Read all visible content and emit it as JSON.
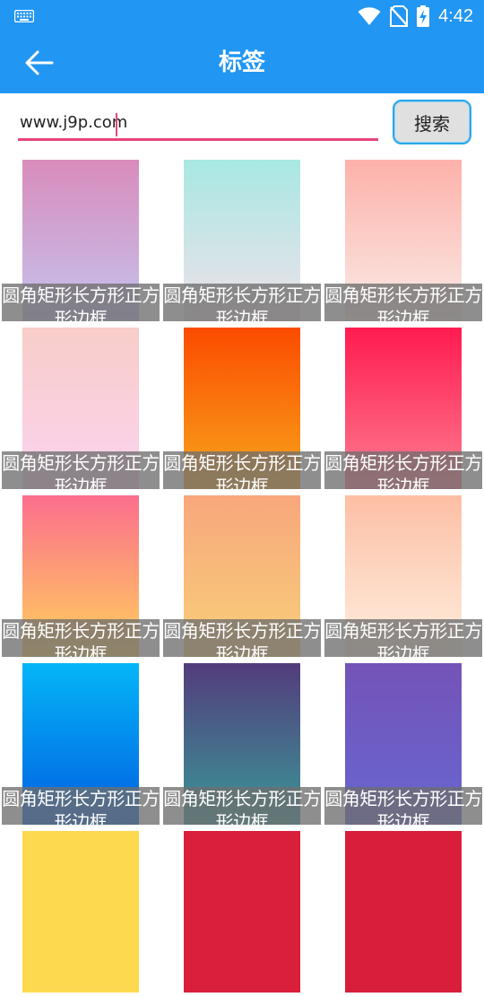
{
  "status_bar": {
    "time": "4:42"
  },
  "app_bar": {
    "title": "标签"
  },
  "search": {
    "value": "www.j9p.com",
    "button_label": "搜索"
  },
  "tiles": [
    {
      "caption": "圆角矩形长方形正方形边框",
      "gradient": [
        "#d98cbc",
        "#c4c3ee"
      ]
    },
    {
      "caption": "圆角矩形长方形正方形边框",
      "gradient": [
        "#a8e8e3",
        "#f0e1e9"
      ]
    },
    {
      "caption": "圆角矩形长方形正方形边框",
      "gradient": [
        "#fdb1aa",
        "#faebe6"
      ]
    },
    {
      "caption": "圆角矩形长方形正方形边框",
      "gradient": [
        "#f8cdc9",
        "#fbd3ef"
      ]
    },
    {
      "caption": "圆角矩形长方形正方形边框",
      "gradient": [
        "#fb4b00",
        "#f8a61c"
      ]
    },
    {
      "caption": "圆角矩形长方形正方形边框",
      "gradient": [
        "#ff1b4f",
        "#fd7d91"
      ]
    },
    {
      "caption": "圆角矩形长方形正方形边框",
      "gradient": [
        "#fb6e8d",
        "#ffd25c"
      ]
    },
    {
      "caption": "圆角矩形长方形正方形边框",
      "gradient": [
        "#f8a77c",
        "#f8cf79"
      ]
    },
    {
      "caption": "圆角矩形长方形正方形边框",
      "gradient": [
        "#fdbfa5",
        "#feefdf"
      ]
    },
    {
      "caption": "圆角矩形长方形正方形边框",
      "gradient": [
        "#04b6f8",
        "#025ee1"
      ]
    },
    {
      "caption": "圆角矩形长方形正方形边框",
      "gradient": [
        "#533c7c",
        "#3a9898"
      ]
    },
    {
      "caption": "圆角矩形长方形正方形边框",
      "gradient": [
        "#7453b7",
        "#6766d2"
      ]
    },
    {
      "caption": "",
      "gradient": [
        "#fdd94f",
        "#fdd94f"
      ]
    },
    {
      "caption": "",
      "gradient": [
        "#d91f3b",
        "#d91f3b"
      ]
    },
    {
      "caption": "",
      "gradient": [
        "#d81e3a",
        "#d81e3a"
      ]
    }
  ]
}
